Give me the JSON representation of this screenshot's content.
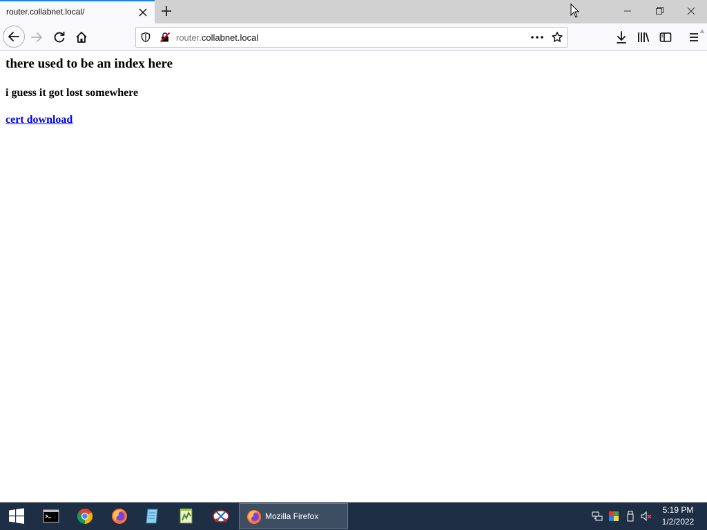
{
  "browser": {
    "tab": {
      "title": "router.collabnet.local/"
    },
    "urlbar": {
      "url_host_sub": "router.",
      "url_host_main": "collabnet.local"
    }
  },
  "page": {
    "heading": "there used to be an index here",
    "subheading": "i guess it got lost somewhere",
    "link_text": "cert download"
  },
  "taskbar": {
    "apps": [
      {
        "name": "windows-start-icon"
      },
      {
        "name": "command-prompt-icon"
      },
      {
        "name": "chrome-icon"
      },
      {
        "name": "firefox-icon"
      },
      {
        "name": "notepad-icon"
      },
      {
        "name": "notepad-plus-plus-icon"
      },
      {
        "name": "snipping-tool-icon"
      }
    ],
    "active_window": {
      "label": "Mozilla Firefox",
      "icon": "firefox-icon"
    },
    "tray": [
      "network-icon",
      "color-icon",
      "usb-icon",
      "volume-muted-icon"
    ],
    "clock": {
      "time": "5:19 PM",
      "date": "1/2/2022"
    }
  },
  "colors": {
    "tab_accent": "#0a84ff",
    "link": "#0000ee",
    "taskbar": "#1e2f45",
    "insecure": "#d70022"
  }
}
